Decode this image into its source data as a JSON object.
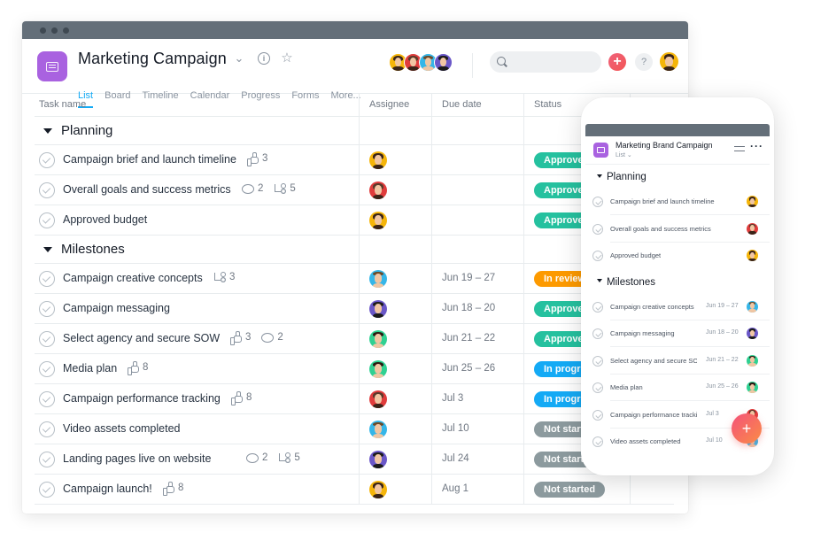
{
  "window": {
    "project_title": "Marketing Campaign",
    "tabs": [
      {
        "label": "List",
        "active": true
      },
      {
        "label": "Board",
        "active": false
      },
      {
        "label": "Timeline",
        "active": false
      },
      {
        "label": "Calendar",
        "active": false
      },
      {
        "label": "Progress",
        "active": false
      },
      {
        "label": "Forms",
        "active": false
      },
      {
        "label": "More...",
        "active": false
      }
    ],
    "header_icons": [
      "chevron-down-icon",
      "info-icon",
      "star-icon"
    ],
    "members": [
      "yellow",
      "red",
      "blue",
      "purple"
    ],
    "search": {
      "value": "",
      "placeholder": ""
    },
    "add_label": "+",
    "help_label": "?"
  },
  "table": {
    "columns": {
      "task": "Task name",
      "assignee": "Assignee",
      "due": "Due date",
      "status": "Status"
    },
    "sections": [
      {
        "name": "Planning",
        "tasks": [
          {
            "name": "Campaign brief and launch timeline",
            "likes": "3",
            "comments": null,
            "subtasks": null,
            "assignee": "yellow",
            "due": "",
            "status": "Approved",
            "status_key": "approved"
          },
          {
            "name": "Overall goals and success metrics",
            "likes": null,
            "comments": "2",
            "subtasks": "5",
            "assignee": "red",
            "due": "",
            "status": "Approved",
            "status_key": "approved"
          },
          {
            "name": "Approved budget",
            "likes": null,
            "comments": null,
            "subtasks": null,
            "assignee": "yellow",
            "due": "",
            "status": "Approved",
            "status_key": "approved"
          }
        ]
      },
      {
        "name": "Milestones",
        "tasks": [
          {
            "name": "Campaign creative concepts",
            "likes": null,
            "comments": null,
            "subtasks": "3",
            "assignee": "blue",
            "due": "Jun 19 – 27",
            "status": "In review",
            "status_key": "review"
          },
          {
            "name": "Campaign messaging",
            "likes": null,
            "comments": null,
            "subtasks": null,
            "assignee": "purple",
            "due": "Jun 18 – 20",
            "status": "Approved",
            "status_key": "approved"
          },
          {
            "name": "Select agency and secure SOW",
            "likes": "3",
            "comments": "2",
            "subtasks": null,
            "assignee": "green",
            "due": "Jun 21 – 22",
            "status": "Approved",
            "status_key": "approved"
          },
          {
            "name": "Media plan",
            "likes": "8",
            "comments": null,
            "subtasks": null,
            "assignee": "green",
            "due": "Jun 25 – 26",
            "status": "In progress",
            "status_key": "progress"
          },
          {
            "name": "Campaign performance tracking",
            "likes": "8",
            "comments": null,
            "subtasks": null,
            "assignee": "red",
            "due": "Jul 3",
            "status": "In progress",
            "status_key": "progress"
          },
          {
            "name": "Video assets completed",
            "likes": null,
            "comments": null,
            "subtasks": null,
            "assignee": "blue",
            "due": "Jul 10",
            "status": "Not started",
            "status_key": "notstarted"
          },
          {
            "name": "Landing pages live on website",
            "likes": null,
            "comments": "2",
            "subtasks": "5",
            "assignee": "purple",
            "due": "Jul 24",
            "status": "Not started",
            "status_key": "notstarted"
          },
          {
            "name": "Campaign launch!",
            "likes": "8",
            "comments": null,
            "subtasks": null,
            "assignee": "yellow",
            "due": "Aug 1",
            "status": "Not started",
            "status_key": "notstarted"
          }
        ]
      }
    ]
  },
  "phone": {
    "project_title": "Marketing Brand Campaign",
    "view_label": "List ⌄",
    "more_label": "···",
    "sections": [
      {
        "name": "Planning",
        "tasks": [
          {
            "name": "Campaign brief and launch timeline",
            "due": "",
            "assignee": "yellow"
          },
          {
            "name": "Overall goals and success metrics",
            "due": "",
            "assignee": "red"
          },
          {
            "name": "Approved budget",
            "due": "",
            "assignee": "yellow"
          }
        ]
      },
      {
        "name": "Milestones",
        "tasks": [
          {
            "name": "Campaign creative concepts",
            "due": "Jun 19 – 27",
            "assignee": "blue"
          },
          {
            "name": "Campaign messaging",
            "due": "Jun 18 – 20",
            "assignee": "purple"
          },
          {
            "name": "Select agency and secure SOW",
            "due": "Jun 21 – 22",
            "assignee": "green"
          },
          {
            "name": "Media plan",
            "due": "Jun 25 – 26",
            "assignee": "green"
          },
          {
            "name": "Campaign performance tracking",
            "due": "Jul 3",
            "assignee": "red"
          },
          {
            "name": "Video assets completed",
            "due": "Jul 10",
            "assignee": "blue"
          }
        ]
      }
    ],
    "fab_label": "+"
  },
  "colors": {
    "accent": "#14aaf5",
    "project": "#a962e0",
    "approved": "#25c19f",
    "in_review": "#fd9a00",
    "in_progress": "#14aaf5",
    "not_started": "#8c9a9e",
    "add": "#f06a6a"
  }
}
